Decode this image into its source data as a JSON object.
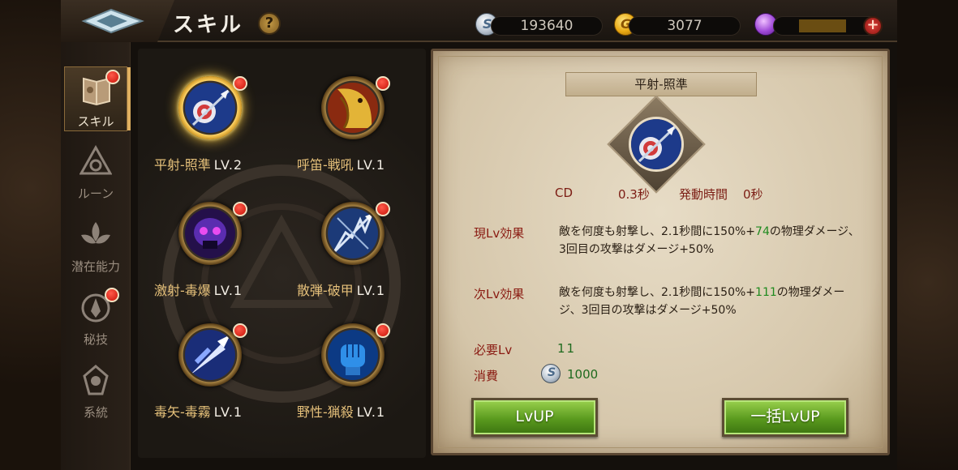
{
  "header": {
    "title": "スキル",
    "help": "?",
    "silver": "193640",
    "gold": "3077",
    "plus": "+"
  },
  "sidebar": {
    "items": [
      {
        "label": "スキル",
        "active": true,
        "badge": true
      },
      {
        "label": "ルーン",
        "active": false,
        "badge": false
      },
      {
        "label": "潜在能力",
        "active": false,
        "badge": false
      },
      {
        "label": "秘技",
        "active": false,
        "badge": true
      },
      {
        "label": "系統",
        "active": false,
        "badge": false
      }
    ]
  },
  "skills": [
    {
      "name": "平射-照準",
      "lv": "LV.2",
      "icon": "spear-target-icon",
      "selected": true
    },
    {
      "name": "呼笛-戦吼",
      "lv": "LV.1",
      "icon": "golden-beast-icon",
      "selected": false
    },
    {
      "name": "激射-毒爆",
      "lv": "LV.1",
      "icon": "poison-skull-icon",
      "selected": false
    },
    {
      "name": "散弾-破甲",
      "lv": "LV.1",
      "icon": "shattered-arrow-icon",
      "selected": false
    },
    {
      "name": "毒矢-毒霧",
      "lv": "LV.1",
      "icon": "energy-arrow-icon",
      "selected": false
    },
    {
      "name": "野性-猟殺",
      "lv": "LV.1",
      "icon": "blue-fist-icon",
      "selected": false
    }
  ],
  "detail": {
    "title": "平射-照準",
    "cd_label": "CD",
    "cd_value": "0.3秒",
    "duration_label": "発動時間",
    "duration_value": "0秒",
    "current_label": "現Lv効果",
    "current_a": "敵を何度も射撃し、2.1秒間に150%+",
    "current_num": "74",
    "current_b": "の物理ダメージ、3回目の攻撃はダメージ+50%",
    "next_label": "次Lv効果",
    "next_a": "敵を何度も射撃し、2.1秒間に150%+",
    "next_num": "111",
    "next_b": "の物理ダメージ、3回目の攻撃はダメージ+50%",
    "req_label": "必要Lv",
    "req_value": "11",
    "cost_label": "消費",
    "cost_value": "1000",
    "btn_lvup": "LvUP",
    "btn_bulk": "一括LvUP"
  },
  "colors": {
    "accent_gold": "#e5c07a",
    "effect_red": "#8a1b12",
    "value_green": "#1e8a1e",
    "button_green": "#5a9a1e"
  }
}
